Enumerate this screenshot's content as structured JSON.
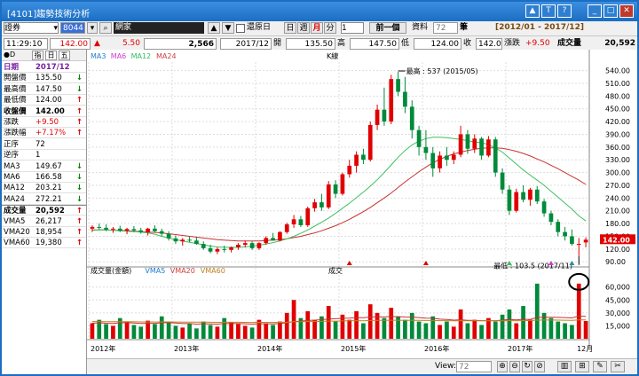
{
  "window": {
    "title": "[4101]趨勢技術分析"
  },
  "toolbar": {
    "market_select": "證券",
    "code": "8044",
    "stock_name": "網家",
    "restore_label": "還原日",
    "periods": [
      "日",
      "週",
      "月",
      "分"
    ],
    "period_active": "月",
    "period_count": "1",
    "prev_label": "前一個",
    "data_label": "資料",
    "data_count": "72",
    "bars_label": "筆",
    "range": "[2012/01 - 2017/12]"
  },
  "quote": {
    "time": "11:29:10",
    "price": "142.00",
    "change": "5.50",
    "volume": "2,566",
    "date": "2017/12",
    "open_label": "開",
    "open": "135.50",
    "high_label": "高",
    "high": "147.50",
    "low_label": "低",
    "low": "124.00",
    "close_label": "收",
    "close": "142.00",
    "chg_label": "漲跌",
    "chg": "+9.50",
    "vol_label": "成交量",
    "vol": "20,592"
  },
  "side": {
    "tabs": [
      "指",
      "日",
      "五"
    ],
    "rows": [
      {
        "label": "日期",
        "value": "2017/12",
        "arrow": ""
      },
      {
        "label": "開盤價",
        "value": "135.50",
        "arrow": "down"
      },
      {
        "label": "最高價",
        "value": "147.50",
        "arrow": "down"
      },
      {
        "label": "最低價",
        "value": "124.00",
        "arrow": "up"
      },
      {
        "label": "收盤價",
        "value": "142.00",
        "arrow": "up"
      },
      {
        "label": "漲跌",
        "value": "+9.50",
        "arrow": "up"
      },
      {
        "label": "漲跌幅",
        "value": "+7.17%",
        "arrow": "up"
      },
      {
        "label": "正序",
        "value": "72",
        "arrow": ""
      },
      {
        "label": "逆序",
        "value": "1",
        "arrow": ""
      },
      {
        "label": "MA3",
        "value": "149.67",
        "arrow": "down"
      },
      {
        "label": "MA6",
        "value": "166.58",
        "arrow": "down"
      },
      {
        "label": "MA12",
        "value": "203.21",
        "arrow": "down"
      },
      {
        "label": "MA24",
        "value": "272.21",
        "arrow": "down"
      },
      {
        "label": "成交量",
        "value": "20,592",
        "arrow": "up"
      },
      {
        "label": "VMA5",
        "value": "26,217",
        "arrow": "up"
      },
      {
        "label": "VMA20",
        "value": "18,954",
        "arrow": "up"
      },
      {
        "label": "VMA60",
        "value": "19,380",
        "arrow": "up"
      }
    ]
  },
  "chart_data": {
    "type": "candlestick",
    "title": "K線",
    "legend": [
      "MA3",
      "MA6",
      "MA12",
      "MA24"
    ],
    "price_ticks": [
      540,
      510,
      480,
      450,
      420,
      390,
      360,
      330,
      300,
      270,
      240,
      210,
      180,
      150,
      120,
      90
    ],
    "price_range": [
      80,
      560
    ],
    "current_price_label": "142.00",
    "high_annotation": "最高 : 537 (2015/05)",
    "low_annotation": "最低 : 103.5 (2017/11)",
    "x_labels": [
      "2012年",
      "2013年",
      "2014年",
      "2015年",
      "2016年",
      "2017年",
      "12月"
    ],
    "candles": [
      [
        168,
        176,
        160,
        172
      ],
      [
        172,
        180,
        166,
        170
      ],
      [
        170,
        178,
        162,
        166
      ],
      [
        166,
        172,
        158,
        168
      ],
      [
        168,
        175,
        160,
        163
      ],
      [
        163,
        170,
        155,
        167
      ],
      [
        167,
        174,
        160,
        164
      ],
      [
        164,
        170,
        156,
        160
      ],
      [
        160,
        170,
        152,
        168
      ],
      [
        168,
        176,
        160,
        162
      ],
      [
        162,
        168,
        150,
        156
      ],
      [
        156,
        162,
        140,
        145
      ],
      [
        145,
        152,
        132,
        138
      ],
      [
        138,
        146,
        128,
        142
      ],
      [
        142,
        150,
        136,
        140
      ],
      [
        140,
        148,
        130,
        132
      ],
      [
        132,
        138,
        118,
        122
      ],
      [
        122,
        130,
        110,
        114
      ],
      [
        114,
        124,
        108,
        120
      ],
      [
        120,
        128,
        112,
        118
      ],
      [
        118,
        126,
        112,
        124
      ],
      [
        124,
        134,
        118,
        130
      ],
      [
        130,
        140,
        124,
        134
      ],
      [
        134,
        138,
        118,
        122
      ],
      [
        122,
        136,
        118,
        134
      ],
      [
        134,
        150,
        130,
        146
      ],
      [
        146,
        158,
        140,
        140
      ],
      [
        140,
        162,
        138,
        160
      ],
      [
        160,
        182,
        156,
        178
      ],
      [
        178,
        200,
        170,
        190
      ],
      [
        190,
        198,
        172,
        176
      ],
      [
        176,
        220,
        172,
        216
      ],
      [
        216,
        238,
        208,
        230
      ],
      [
        230,
        250,
        210,
        218
      ],
      [
        218,
        280,
        214,
        272
      ],
      [
        272,
        282,
        240,
        250
      ],
      [
        250,
        300,
        246,
        296
      ],
      [
        296,
        330,
        288,
        316
      ],
      [
        316,
        350,
        300,
        342
      ],
      [
        342,
        356,
        320,
        330
      ],
      [
        330,
        420,
        326,
        412
      ],
      [
        412,
        460,
        400,
        448
      ],
      [
        448,
        500,
        410,
        420
      ],
      [
        420,
        530,
        414,
        520
      ],
      [
        520,
        537,
        480,
        490
      ],
      [
        490,
        525,
        440,
        455
      ],
      [
        455,
        470,
        380,
        400
      ],
      [
        400,
        410,
        340,
        360
      ],
      [
        360,
        400,
        330,
        346
      ],
      [
        346,
        360,
        290,
        310
      ],
      [
        310,
        350,
        300,
        340
      ],
      [
        340,
        360,
        316,
        330
      ],
      [
        330,
        350,
        320,
        342
      ],
      [
        342,
        410,
        336,
        390
      ],
      [
        390,
        400,
        344,
        356
      ],
      [
        356,
        390,
        346,
        380
      ],
      [
        380,
        384,
        330,
        340
      ],
      [
        340,
        386,
        336,
        378
      ],
      [
        378,
        384,
        290,
        300
      ],
      [
        300,
        310,
        250,
        260
      ],
      [
        260,
        270,
        200,
        210
      ],
      [
        210,
        262,
        206,
        254
      ],
      [
        254,
        270,
        230,
        236
      ],
      [
        236,
        264,
        222,
        260
      ],
      [
        260,
        268,
        226,
        232
      ],
      [
        232,
        238,
        196,
        204
      ],
      [
        204,
        210,
        176,
        184
      ],
      [
        184,
        190,
        150,
        160
      ],
      [
        160,
        172,
        140,
        150
      ],
      [
        150,
        166,
        128,
        132
      ],
      [
        132,
        146,
        103.5,
        132
      ],
      [
        135.5,
        147.5,
        124,
        142
      ]
    ],
    "ma12": [
      164,
      165,
      165,
      164,
      163,
      162,
      161,
      160,
      158,
      155,
      150,
      146,
      142,
      139,
      136,
      133,
      130,
      127,
      125,
      124,
      124,
      124,
      125,
      127,
      129,
      132,
      135,
      139,
      144,
      150,
      157,
      165,
      174,
      183,
      193,
      204,
      216,
      228,
      241,
      254,
      268,
      283,
      300,
      318,
      336,
      352,
      365,
      374,
      380,
      383,
      383,
      382,
      380,
      378,
      375,
      372,
      370,
      366,
      358,
      348,
      334,
      320,
      306,
      294,
      282,
      270,
      256,
      242,
      228,
      214,
      198,
      186
    ],
    "ma24": [
      165,
      165,
      165,
      164,
      164,
      163,
      162,
      161,
      160,
      159,
      158,
      156,
      154,
      152,
      150,
      148,
      146,
      144,
      142,
      141,
      140,
      139,
      139,
      139,
      139,
      140,
      141,
      142,
      144,
      147,
      150,
      154,
      158,
      163,
      169,
      175,
      182,
      190,
      199,
      208,
      218,
      229,
      240,
      252,
      265,
      278,
      290,
      302,
      313,
      323,
      331,
      338,
      344,
      348,
      352,
      355,
      357,
      358,
      358,
      357,
      354,
      350,
      345,
      339,
      332,
      325,
      317,
      309,
      300,
      291,
      282,
      272
    ],
    "volume": {
      "title": "成交量(金額)",
      "center_title": "成交",
      "legend": [
        "VMA5",
        "VMA20",
        "VMA60"
      ],
      "ticks": [
        60000,
        45000,
        30000,
        15000
      ],
      "range": [
        0,
        70000
      ],
      "bars": [
        18000,
        22000,
        17000,
        15000,
        24000,
        20000,
        16000,
        14000,
        21000,
        17000,
        26000,
        19000,
        15000,
        13000,
        18000,
        12000,
        20000,
        16000,
        14000,
        24000,
        19000,
        17000,
        15000,
        13000,
        22000,
        18000,
        16000,
        20000,
        30000,
        45000,
        24000,
        32000,
        22000,
        26000,
        38000,
        20000,
        28000,
        22000,
        32000,
        18000,
        40000,
        30000,
        24000,
        36000,
        26000,
        22000,
        30000,
        20000,
        18000,
        26000,
        16000,
        20000,
        14000,
        34000,
        18000,
        22000,
        16000,
        24000,
        20000,
        28000,
        34000,
        18000,
        38000,
        22000,
        64000,
        30000,
        24000,
        20000,
        18000,
        16000,
        64000,
        20592
      ],
      "vma20": [
        18000,
        18500,
        18000,
        17800,
        18500,
        18600,
        18200,
        17800,
        18000,
        17800,
        18600,
        18600,
        18200,
        17600,
        17600,
        17000,
        17400,
        17200,
        17000,
        17600,
        17700,
        17600,
        17400,
        17000,
        17500,
        17400,
        17300,
        17600,
        18600,
        20000,
        20400,
        21200,
        21600,
        22100,
        23000,
        23300,
        23800,
        24000,
        24600,
        24400,
        25200,
        25400,
        25300,
        25800,
        25600,
        25300,
        25200,
        24600,
        24000,
        23800,
        22800,
        22400,
        21600,
        22000,
        21400,
        21400,
        21000,
        21000,
        21000,
        21600,
        22400,
        21800,
        22600,
        22400,
        24800,
        25000,
        25000,
        24800,
        24600,
        24200,
        26200,
        26000
      ],
      "vma60": [
        20000,
        20000,
        19900,
        19800,
        19800,
        19800,
        19700,
        19600,
        19600,
        19500,
        19600,
        19600,
        19500,
        19400,
        19300,
        19200,
        19200,
        19100,
        19000,
        19100,
        19100,
        19100,
        19000,
        18900,
        19000,
        19000,
        18900,
        19000,
        19300,
        19700,
        19800,
        20000,
        20100,
        20200,
        20500,
        20500,
        20700,
        20800,
        21000,
        20900,
        21200,
        21300,
        21300,
        21500,
        21500,
        21400,
        21500,
        21300,
        21200,
        21200,
        21000,
        21000,
        20800,
        21000,
        20900,
        20900,
        20800,
        20800,
        20800,
        20900,
        21100,
        20900,
        21100,
        21100,
        21600,
        21700,
        21700,
        21600,
        21500,
        21400,
        21900,
        21800
      ]
    }
  },
  "footer": {
    "view_label": "View:",
    "view_value": "72"
  }
}
